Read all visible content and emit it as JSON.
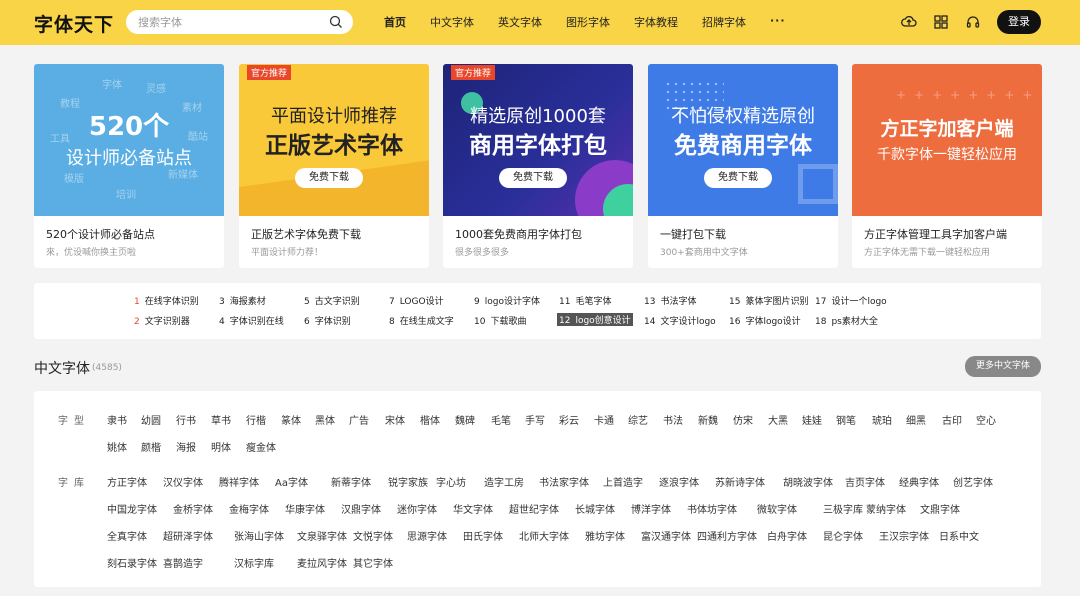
{
  "header": {
    "logo": "字体天下",
    "search_placeholder": "搜索字体",
    "nav": [
      {
        "label": "首页"
      },
      {
        "label": "中文字体"
      },
      {
        "label": "英文字体"
      },
      {
        "label": "图形字体"
      },
      {
        "label": "字体教程"
      },
      {
        "label": "招牌字体"
      },
      {
        "label": "···"
      }
    ],
    "login": "登录"
  },
  "banners": [
    {
      "line1": "520个",
      "line2": "设计师必备站点",
      "title": "520个设计师必备站点",
      "subtitle": "來，优设喊你换主页啦",
      "deco": [
        "字体",
        "灵感",
        "教程",
        "素材",
        "工具",
        "酷站",
        "模版",
        "培训",
        "新媒体"
      ]
    },
    {
      "tag": "官方推荐",
      "line1": "平面设计师推荐",
      "line2": "正版艺术字体",
      "button": "免费下载",
      "title": "正版艺术字体免费下载",
      "subtitle": "平面设计师力荐！"
    },
    {
      "tag": "官方推荐",
      "line1": "精选原创1000套",
      "line2": "商用字体打包",
      "button": "免费下载",
      "title": "1000套免费商用字体打包",
      "subtitle": "很多很多很多"
    },
    {
      "line1": "不怕侵权精选原创",
      "line2": "免费商用字体",
      "button": "免费下载",
      "title": "一键打包下载",
      "subtitle": "300+套商用中文字体"
    },
    {
      "line1": "方正字加客户端",
      "line2": "千款字体一键轻松应用",
      "title": "方正字体管理工具字加客户端",
      "subtitle": "方正字体无需下载一键轻松应用"
    }
  ],
  "hot": [
    {
      "num": "1",
      "text": "在线字体识别"
    },
    {
      "num": "2",
      "text": "文字识别器"
    },
    {
      "num": "3",
      "text": "海报素材"
    },
    {
      "num": "4",
      "text": "字体识别在线"
    },
    {
      "num": "5",
      "text": "古文字识别"
    },
    {
      "num": "6",
      "text": "字体识别"
    },
    {
      "num": "7",
      "text": "LOGO设计"
    },
    {
      "num": "8",
      "text": "在线生成文字"
    },
    {
      "num": "9",
      "text": "logo设计字体"
    },
    {
      "num": "10",
      "text": "下载歌曲"
    },
    {
      "num": "11",
      "text": "毛笔字体"
    },
    {
      "num": "12",
      "text": "logo创意设计"
    },
    {
      "num": "13",
      "text": "书法字体"
    },
    {
      "num": "14",
      "text": "文字设计logo"
    },
    {
      "num": "15",
      "text": "篆体字图片识别"
    },
    {
      "num": "16",
      "text": "字体logo设计"
    },
    {
      "num": "17",
      "text": "设计一个logo"
    },
    {
      "num": "18",
      "text": "ps素材大全"
    }
  ],
  "section": {
    "title": "中文字体",
    "count": "(4585)",
    "more": "更多中文字体",
    "type_label": "字型",
    "lib_label": "字库",
    "types": [
      "隶书",
      "幼圆",
      "行书",
      "草书",
      "行楷",
      "篆体",
      "黑体",
      "广告",
      "宋体",
      "楷体",
      "魏碑",
      "毛笔",
      "手写",
      "彩云",
      "卡通",
      "综艺",
      "书法",
      "新魏",
      "仿宋",
      "大黑",
      "娃娃",
      "钢笔",
      "琥珀",
      "细黑",
      "古印",
      "空心",
      "姚体",
      "颜楷",
      "海报",
      "明体",
      "瘦金体"
    ],
    "libs": [
      "方正字体",
      "汉仪字体",
      "腾祥字体",
      "Aa字体",
      "新蒂字体",
      "锐字家族",
      "字心坊",
      "造字工房",
      "书法家字体",
      "上首造字",
      "逐浪字体",
      "苏新诗字体",
      "胡晓波字体",
      "吉页字体",
      "经典字体",
      "创艺字体",
      "中国龙字体",
      "金桥字体",
      "金梅字体",
      "华康字体",
      "汉鼎字体",
      "迷你字体",
      "华文字体",
      "超世纪字体",
      "长城字体",
      "博洋字体",
      "书体坊字体",
      "微软字体",
      "三极字库",
      "蒙纳字体",
      "文鼎字体",
      "全真字体",
      "超研泽字体",
      "张海山字体",
      "文泉驿字体",
      "文悦字体",
      "思源字体",
      "田氏字体",
      "北师大字体",
      "雅坊字体",
      "富汉通字体",
      "四通利方字体",
      "白舟字体",
      "昆仑字体",
      "王汉宗字体",
      "日系中文",
      "刻石录字体",
      "喜鹊造字",
      "汉标字库",
      "麦拉风字体",
      "其它字体"
    ]
  },
  "colors": {
    "header": "#f9d447",
    "tag": "#e8472a",
    "banner1": "#5aaee3",
    "banner2": "#f9c93a",
    "banner3": "#1f2a8a",
    "banner4": "#3f7be6",
    "banner5": "#ee6d3f"
  }
}
